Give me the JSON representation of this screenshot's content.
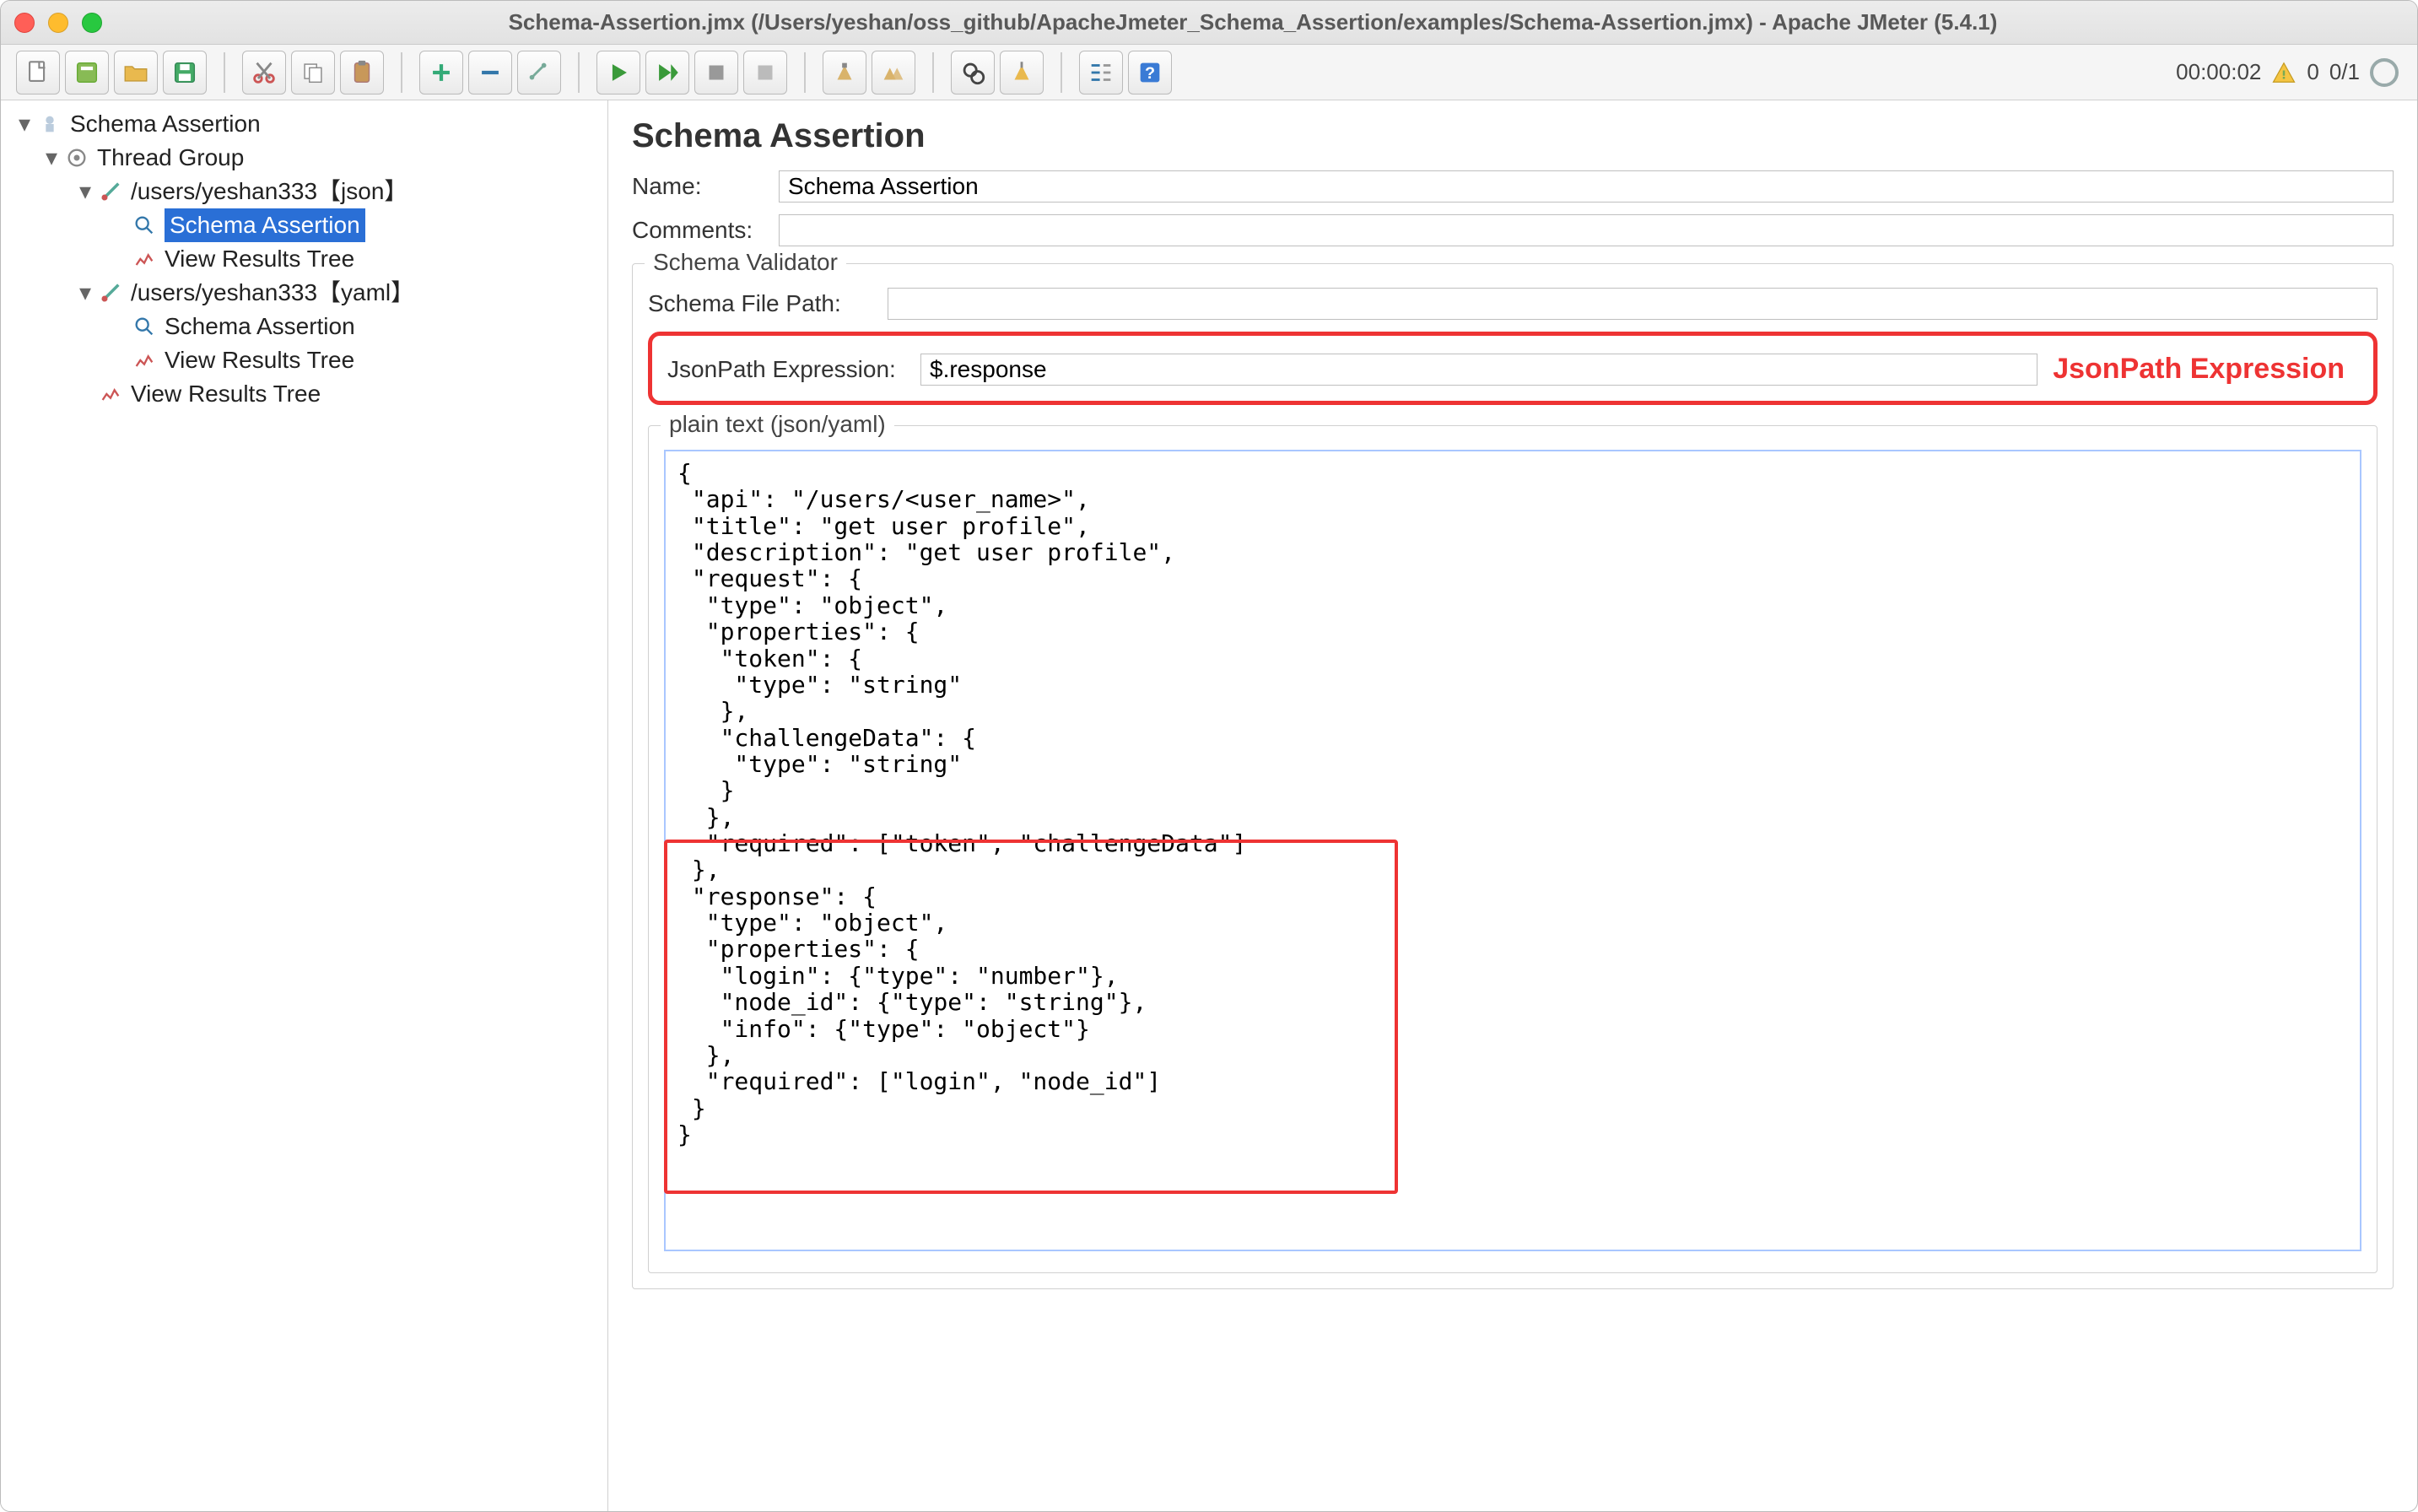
{
  "window": {
    "title": "Schema-Assertion.jmx (/Users/yeshan/oss_github/ApacheJmeter_Schema_Assertion/examples/Schema-Assertion.jmx) - Apache JMeter (5.4.1)"
  },
  "toolbar_status": {
    "time": "00:00:02",
    "warnings": "0",
    "threads": "0/1"
  },
  "tree": {
    "root": "Schema Assertion",
    "thread_group": "Thread Group",
    "sampler_json": "/users/yeshan333【json】",
    "sa_json": "Schema Assertion",
    "vrt_json": "View Results Tree",
    "sampler_yaml": "/users/yeshan333【yaml】",
    "sa_yaml": "Schema Assertion",
    "vrt_yaml": "View Results Tree",
    "vrt_root": "View Results Tree"
  },
  "main": {
    "heading": "Schema Assertion",
    "name_label": "Name:",
    "name_value": "Schema Assertion",
    "comments_label": "Comments:",
    "comments_value": "",
    "validator_legend": "Schema Validator",
    "schema_file_label": "Schema File Path:",
    "schema_file_value": "",
    "jsonpath_label": "JsonPath Expression:",
    "jsonpath_value": "$.response",
    "callout_label": "JsonPath Expression",
    "plain_legend": "plain text (json/yaml)",
    "schema_text": "{\n \"api\": \"/users/<user_name>\",\n \"title\": \"get user profile\",\n \"description\": \"get user profile\",\n \"request\": {\n  \"type\": \"object\",\n  \"properties\": {\n   \"token\": {\n    \"type\": \"string\"\n   },\n   \"challengeData\": {\n    \"type\": \"string\"\n   }\n  },\n  \"required\": [\"token\", \"challengeData\"]\n },\n \"response\": {\n  \"type\": \"object\",\n  \"properties\": {\n   \"login\": {\"type\": \"number\"},\n   \"node_id\": {\"type\": \"string\"},\n   \"info\": {\"type\": \"object\"}\n  },\n  \"required\": [\"login\", \"node_id\"]\n }\n}"
  }
}
